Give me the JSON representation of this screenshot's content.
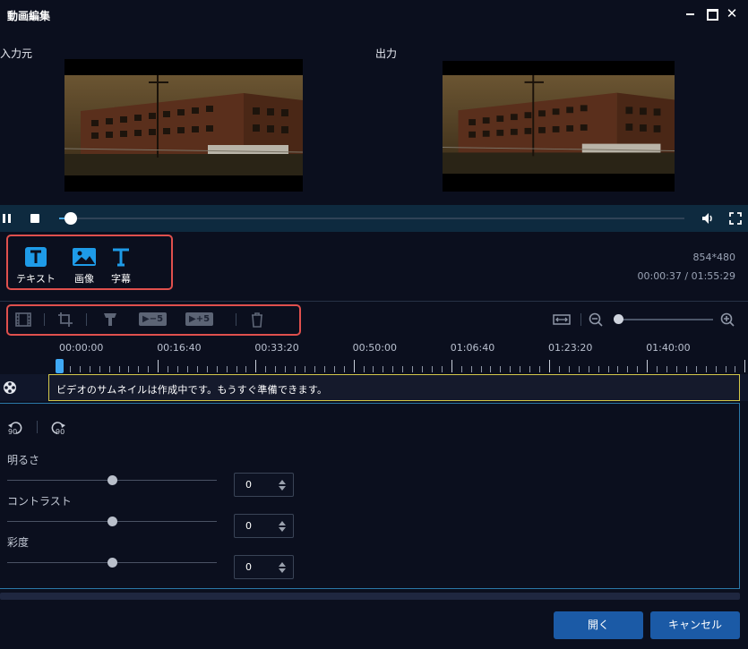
{
  "window": {
    "title": "動画編集"
  },
  "labels": {
    "input": "入力元",
    "output": "出力"
  },
  "toolbox": {
    "items": [
      {
        "label": "テキスト",
        "icon": "text-icon"
      },
      {
        "label": "画像",
        "icon": "image-icon"
      },
      {
        "label": "字幕",
        "icon": "subtitle-icon"
      }
    ]
  },
  "video_info": {
    "resolution": "854*480",
    "time": "00:00:37 / 01:55:29"
  },
  "edit_toolbar": {
    "minus5": "−5",
    "plus5": "+5"
  },
  "playback": {
    "progress": 0.01
  },
  "timeline": {
    "labels": [
      "00:00:00",
      "00:16:40",
      "00:33:20",
      "00:50:00",
      "01:06:40",
      "01:23:20",
      "01:40:00"
    ],
    "clip_message": "ビデオのサムネイルは作成中です。もうすぐ準備できます。"
  },
  "adjustments": {
    "rotate_left": "90",
    "rotate_right": "90",
    "sliders": [
      {
        "label": "明るさ",
        "value": "0"
      },
      {
        "label": "コントラスト",
        "value": "0"
      },
      {
        "label": "彩度",
        "value": "0"
      }
    ]
  },
  "buttons": {
    "open": "開く",
    "cancel": "キャンセル"
  },
  "colors": {
    "accent": "#1b5aa6",
    "highlight": "#e0504d",
    "playhead": "#3fa9f5"
  }
}
